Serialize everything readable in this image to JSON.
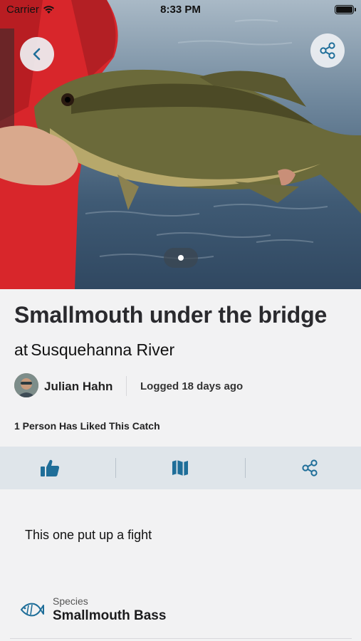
{
  "status_bar": {
    "carrier": "Carrier",
    "time": "8:33 PM"
  },
  "hero": {
    "page_indicator": {
      "total": 1,
      "current": 1
    },
    "back_icon": "chevron-left-icon",
    "share_icon": "share-icon"
  },
  "catch": {
    "title": "Smallmouth under the bridge",
    "location_prefix": "at",
    "location": "Susquehanna River",
    "author": "Julian Hahn",
    "logged": "Logged 18 days ago",
    "likes_text": "1 Person Has Liked This Catch",
    "description": "This one put up a fight"
  },
  "actions": [
    {
      "name": "like",
      "icon": "thumbs-up-icon"
    },
    {
      "name": "map",
      "icon": "map-icon"
    },
    {
      "name": "share",
      "icon": "share-icon"
    }
  ],
  "details": {
    "species_label": "Species",
    "species_value": "Smallmouth Bass",
    "species_icon": "fish-icon"
  },
  "colors": {
    "accent": "#1f6e99",
    "action_bar": "#dfe5ea",
    "background": "#f2f2f3"
  }
}
